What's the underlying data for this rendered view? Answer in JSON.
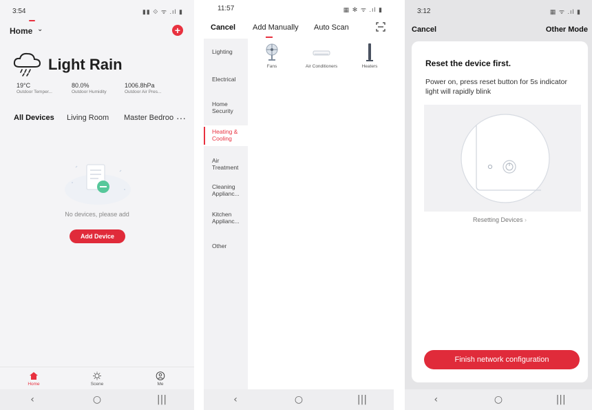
{
  "phone1": {
    "status": {
      "time": "3:54",
      "icons": "▮▮ ⟐ ᯤ .ıl ▮"
    },
    "header": {
      "title": "Home",
      "chevron": "⌄",
      "add_icon": "plus-circle-icon"
    },
    "weather": {
      "condition": "Light Rain",
      "stats": [
        {
          "value": "19°C",
          "label": "Outdoor Temper..."
        },
        {
          "value": "80.0%",
          "label": "Outdoor Humidity"
        },
        {
          "value": "1006.8hPa",
          "label": "Outdoor Air Pres..."
        }
      ]
    },
    "tabs": [
      "All Devices",
      "Living Room",
      "Master Bedroo",
      "···"
    ],
    "empty_text": "No devices, please add",
    "add_button": "Add Device",
    "bottom_tabs": [
      {
        "label": "Home",
        "icon": "home-icon"
      },
      {
        "label": "Scene",
        "icon": "sun-icon"
      },
      {
        "label": "Me",
        "icon": "user-icon"
      }
    ],
    "accent": "#e8313f"
  },
  "phone2": {
    "status": {
      "time": "11:57",
      "icons": "▦ ✻ ᯤ .ıl ▮"
    },
    "header": {
      "cancel": "Cancel",
      "tab_manual": "Add Manually",
      "tab_scan": "Auto Scan"
    },
    "categories": [
      "Lighting",
      "Electrical",
      "Home Security",
      "Heating & Cooling",
      "Air Treatment",
      "Cleaning Applianc...",
      "Kitchen Applianc...",
      "Other"
    ],
    "active_category": "Heating & Cooling",
    "devices": [
      {
        "label": "Fans",
        "icon": "fan-icon"
      },
      {
        "label": "Air Conditioners",
        "icon": "air-conditioner-icon"
      },
      {
        "label": "Heaters",
        "icon": "heater-icon"
      }
    ]
  },
  "phone3": {
    "status": {
      "time": "3:12",
      "icons": "▦ ᯤ .ıl ▮"
    },
    "header": {
      "cancel": "Cancel",
      "other_mode": "Other Mode"
    },
    "card": {
      "title": "Reset the device first.",
      "description": "Power on, press reset button for 5s indicator light will rapidly blink",
      "link": "Resetting Devices",
      "link_chevron": "›",
      "button": "Finish network configuration"
    }
  },
  "navbar": {
    "back": "‹",
    "home": "○",
    "recents": "|||"
  }
}
